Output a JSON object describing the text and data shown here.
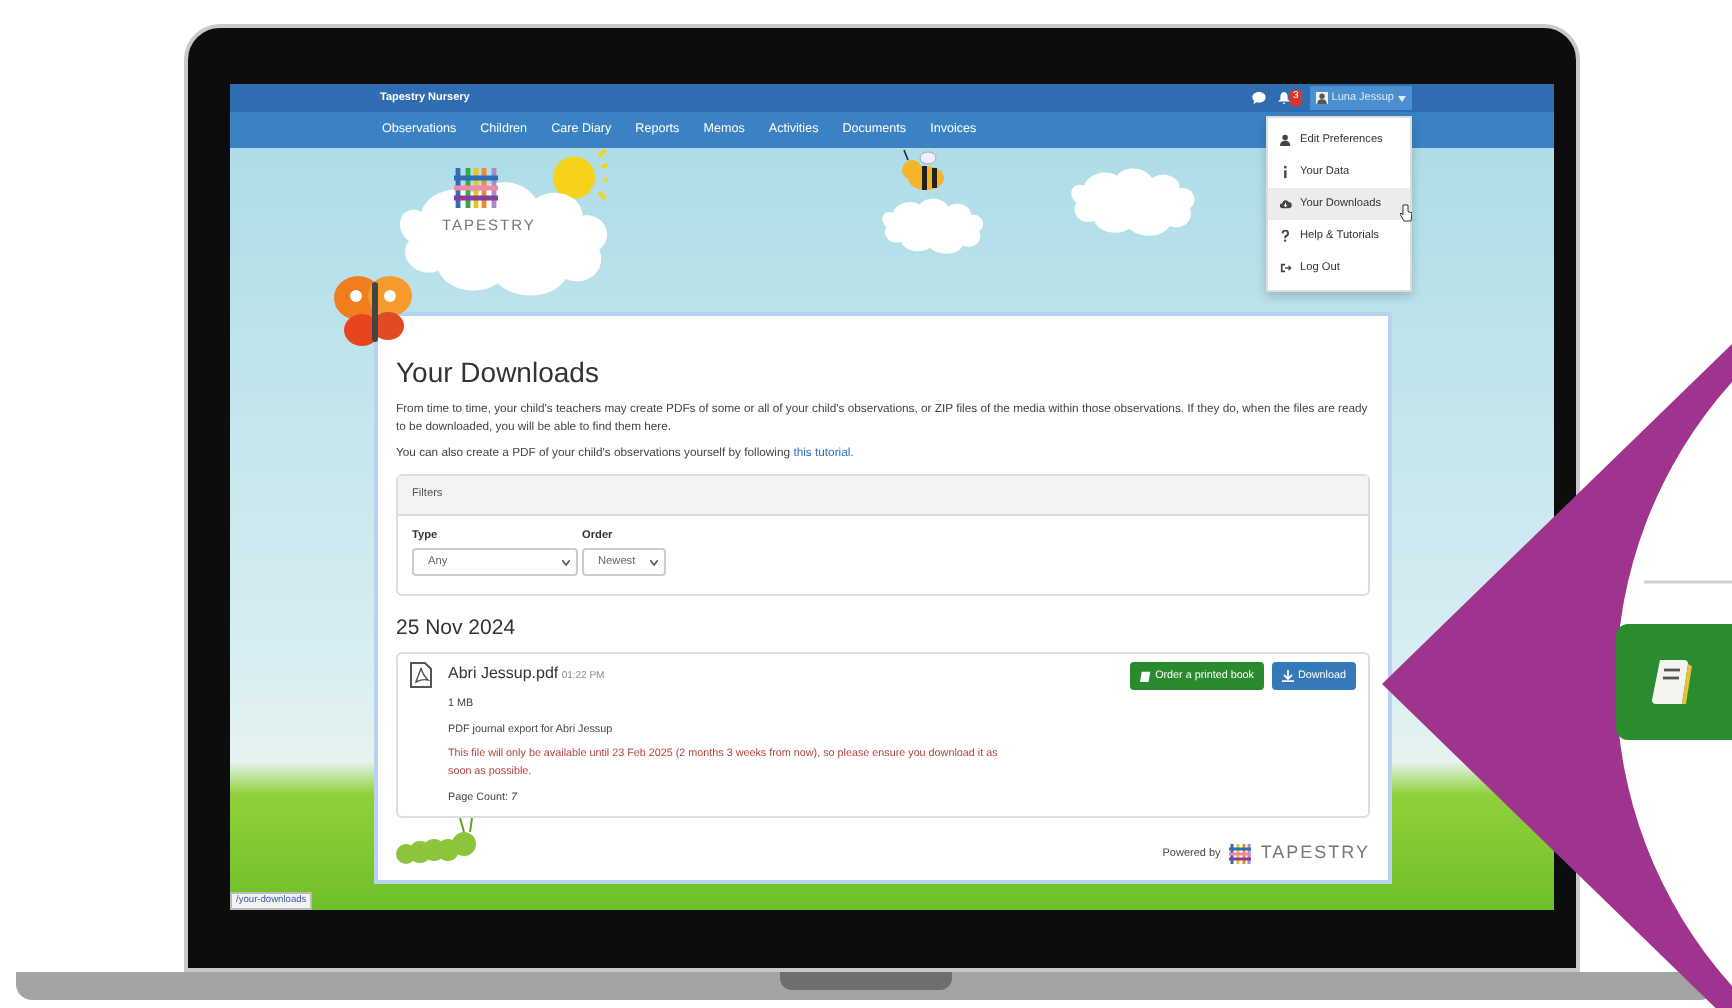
{
  "navbar": {
    "brand": "Tapestry Nursery",
    "notification_count": "3",
    "user_name": "Luna Jessup",
    "links": [
      "Observations",
      "Children",
      "Care Diary",
      "Reports",
      "Memos",
      "Activities",
      "Documents",
      "Invoices"
    ]
  },
  "user_menu": {
    "expanded": true,
    "items": [
      {
        "label": "Edit Preferences",
        "kind": "preferences",
        "selected": false
      },
      {
        "label": "Your Data",
        "kind": "data",
        "selected": false
      },
      {
        "label": "Your Downloads",
        "kind": "downloads",
        "selected": true
      },
      {
        "label": "Help & Tutorials",
        "kind": "help",
        "selected": false
      },
      {
        "label": "Log Out",
        "kind": "logout",
        "selected": false
      }
    ]
  },
  "header": {
    "logo_text": "TAPESTRY"
  },
  "page": {
    "title": "Your Downloads",
    "intro": "From time to time, your child's teachers may create PDFs of some or all of your child's observations, or ZIP files of the media within those observations. If they do, when the files are ready to be downloaded, you will be able to find them here.",
    "tutorial_text": "You can also create a PDF of your child's observations yourself by following",
    "tutorial_link": "this tutorial."
  },
  "filters": {
    "heading": "Filters",
    "fields": [
      {
        "label": "Type",
        "value": "Any"
      },
      {
        "label": "Order",
        "value": "Newest"
      }
    ]
  },
  "downloads": [
    {
      "date": "25 Nov 2024",
      "files": [
        {
          "name": "Abri Jessup.pdf",
          "time": "01:22 PM",
          "size": "1 MB",
          "description": "PDF journal export for Abri Jessup",
          "warning": "This file will only be available until 23 Feb 2025 (2 months 3 weeks from now), so please ensure you download it as soon as possible.",
          "page_count": "Page Count: *7*",
          "buttons": [
            {
              "label": "Order a printed book",
              "kind": "order"
            },
            {
              "label": "Download",
              "kind": "download"
            }
          ]
        }
      ]
    }
  ],
  "footer": {
    "powered_by": "Powered by",
    "logo_text": "TAPESTRY"
  },
  "status_bar": "/your-downloads"
}
